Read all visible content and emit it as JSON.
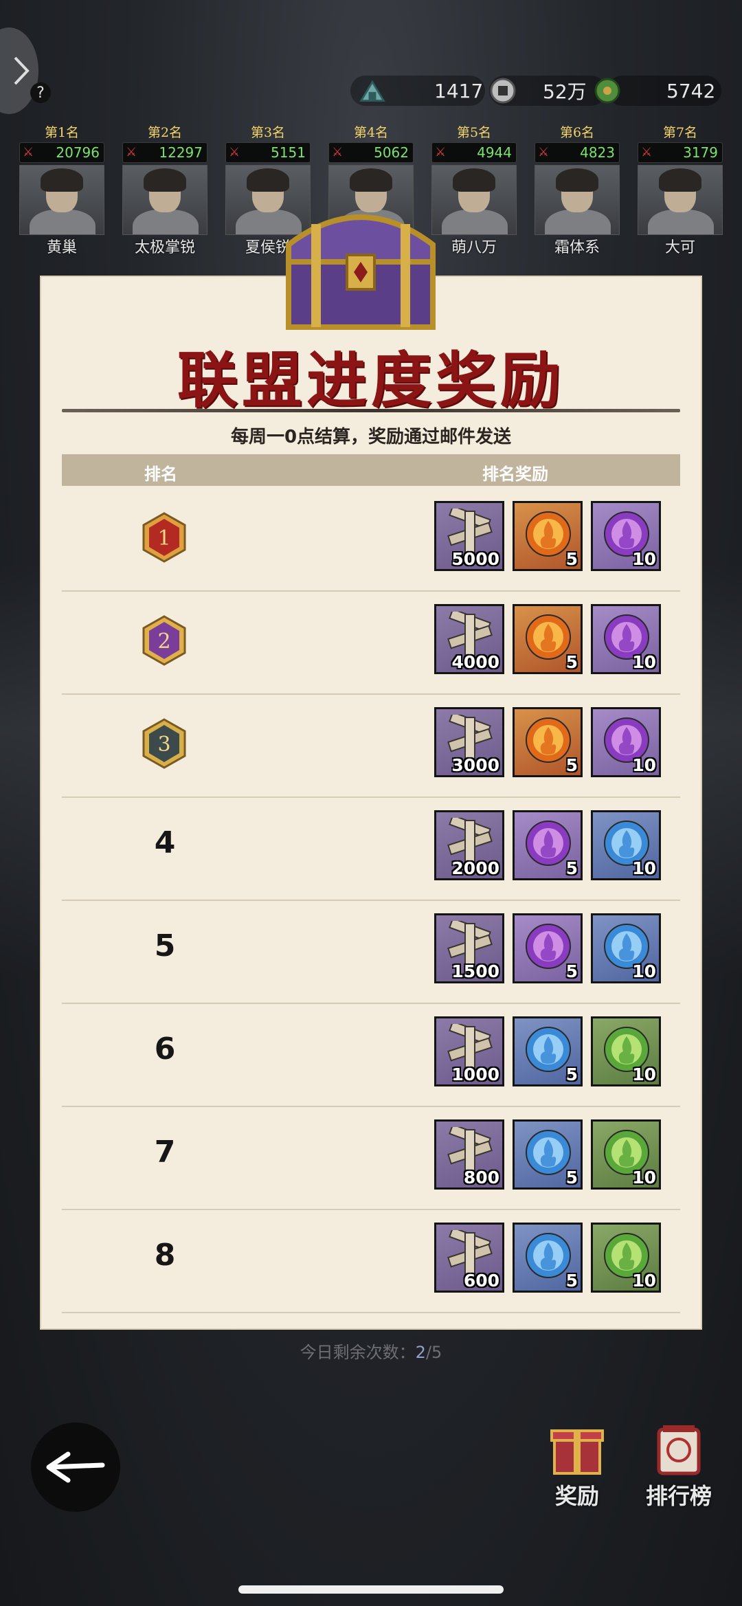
{
  "top_bar": {
    "help_label": "?",
    "resources": [
      {
        "icon": "silver-coin-icon",
        "value": "1417"
      },
      {
        "icon": "copper-coin-icon",
        "value": "52万"
      },
      {
        "icon": "jade-icon",
        "value": "5742"
      }
    ]
  },
  "leaderboard": [
    {
      "rank": "第1名",
      "score": "20796",
      "name": "黄巢"
    },
    {
      "rank": "第2名",
      "score": "12297",
      "name": "太极掌锐"
    },
    {
      "rank": "第3名",
      "score": "5151",
      "name": "夏侯锐"
    },
    {
      "rank": "第4名",
      "score": "5062",
      "name": ""
    },
    {
      "rank": "第5名",
      "score": "4944",
      "name": "萌八万"
    },
    {
      "rank": "第6名",
      "score": "4823",
      "name": "霜体系"
    },
    {
      "rank": "第7名",
      "score": "3179",
      "name": "大可"
    }
  ],
  "modal": {
    "title": "联盟进度奖励",
    "subtitle": "每周一0点结算，奖励通过邮件发送",
    "col_rank": "排名",
    "col_reward": "排名奖励",
    "rows": [
      {
        "rank": "1",
        "medal": "red",
        "items": [
          {
            "type": "wood",
            "count": "5000"
          },
          {
            "type": "orb-orange",
            "count": "5"
          },
          {
            "type": "orb-purple",
            "count": "10"
          }
        ]
      },
      {
        "rank": "2",
        "medal": "purple",
        "items": [
          {
            "type": "wood",
            "count": "4000"
          },
          {
            "type": "orb-orange",
            "count": "5"
          },
          {
            "type": "orb-purple",
            "count": "10"
          }
        ]
      },
      {
        "rank": "3",
        "medal": "gray",
        "items": [
          {
            "type": "wood",
            "count": "3000"
          },
          {
            "type": "orb-orange",
            "count": "5"
          },
          {
            "type": "orb-purple",
            "count": "10"
          }
        ]
      },
      {
        "rank": "4",
        "medal": "",
        "items": [
          {
            "type": "wood",
            "count": "2000"
          },
          {
            "type": "orb-purple",
            "count": "5"
          },
          {
            "type": "orb-blue",
            "count": "10"
          }
        ]
      },
      {
        "rank": "5",
        "medal": "",
        "items": [
          {
            "type": "wood",
            "count": "1500"
          },
          {
            "type": "orb-purple",
            "count": "5"
          },
          {
            "type": "orb-blue",
            "count": "10"
          }
        ]
      },
      {
        "rank": "6",
        "medal": "",
        "items": [
          {
            "type": "wood",
            "count": "1000"
          },
          {
            "type": "orb-blue",
            "count": "5"
          },
          {
            "type": "orb-green",
            "count": "10"
          }
        ]
      },
      {
        "rank": "7",
        "medal": "",
        "items": [
          {
            "type": "wood",
            "count": "800"
          },
          {
            "type": "orb-blue",
            "count": "5"
          },
          {
            "type": "orb-green",
            "count": "10"
          }
        ]
      },
      {
        "rank": "8",
        "medal": "",
        "items": [
          {
            "type": "wood",
            "count": "600"
          },
          {
            "type": "orb-blue",
            "count": "5"
          },
          {
            "type": "orb-green",
            "count": "10"
          }
        ]
      }
    ]
  },
  "footer": {
    "remaining_label": "今日剩余次数：",
    "remaining_used": "2",
    "remaining_total": "/5",
    "rewards_label": "奖励",
    "ranking_label": "排行榜"
  },
  "colors": {
    "title_red": "#8b1414",
    "modal_bg": "#f4ecdd",
    "score_green": "#7be36b",
    "rank_gold": "#f2d36a"
  }
}
